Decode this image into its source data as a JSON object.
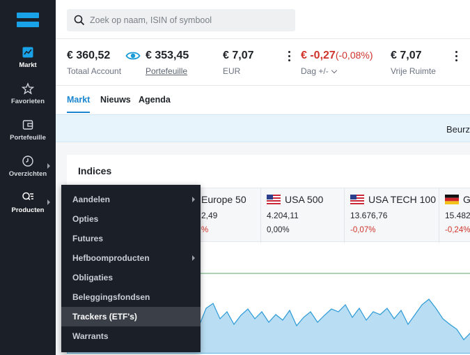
{
  "sidebar": {
    "items": [
      {
        "label": "Markt",
        "icon": "chart-icon"
      },
      {
        "label": "Favorieten",
        "icon": "star-icon"
      },
      {
        "label": "Portefeuille",
        "icon": "wallet-icon"
      },
      {
        "label": "Overzichten",
        "icon": "clock-icon"
      },
      {
        "label": "Producten",
        "icon": "search-list-icon"
      }
    ]
  },
  "search": {
    "placeholder": "Zoek op naam, ISIN of symbool"
  },
  "account": {
    "total_value": "€ 360,52",
    "total_label": "Totaal Account",
    "portfolio_value": "€ 353,45",
    "portfolio_label": "Portefeuille",
    "eur_value": "€ 7,07",
    "eur_label": "EUR",
    "day_change": "€ -0,27",
    "day_change_pct": "(-0,08%)",
    "day_label": "Dag +/-",
    "free_value": "€ 7,07",
    "free_label": "Vrije Ruimte"
  },
  "tabs": [
    "Markt",
    "Nieuws",
    "Agenda"
  ],
  "banner": {
    "text": "Beurz"
  },
  "indices": {
    "title": "Indices",
    "tiles": [
      {
        "name": "Europe 50",
        "price": "2,49",
        "change": "%"
      },
      {
        "name": "USA 500",
        "price": "4.204,11",
        "change": "0,00%"
      },
      {
        "name": "USA TECH 100",
        "price": "13.676,76",
        "change": "-0,07%"
      },
      {
        "name": "G",
        "price": "15.482",
        "change": "-0,24%"
      }
    ]
  },
  "menu": {
    "items": [
      {
        "label": "Aandelen"
      },
      {
        "label": "Opties"
      },
      {
        "label": "Futures"
      },
      {
        "label": "Hefboomproducten"
      },
      {
        "label": "Obligaties"
      },
      {
        "label": "Beleggingsfondsen"
      },
      {
        "label": "Trackers (ETF's)"
      },
      {
        "label": "Warrants"
      }
    ],
    "active": "Trackers (ETF's)"
  },
  "colors": {
    "accent": "#1a86d0",
    "negative": "#d0332c",
    "sidebar_bg": "#1b1f27",
    "chart_fill": "#b9ddf2",
    "chart_line": "#2b9ad8",
    "reference_line": "#5aa86a"
  }
}
